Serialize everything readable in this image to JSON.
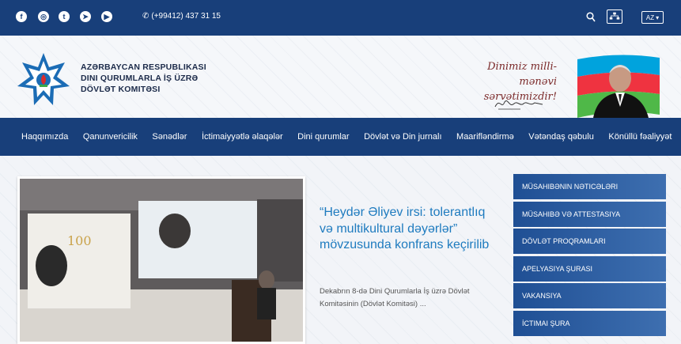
{
  "topbar": {
    "social_icons": [
      "facebook-icon",
      "instagram-icon",
      "twitter-icon",
      "telegram-icon",
      "youtube-icon"
    ],
    "phone": "(+99412) 437 31 15",
    "language": "AZ"
  },
  "header": {
    "org_line1": "Azərbaycan Respublikası",
    "org_line2": "Dini Qurumlarla İş üzrə",
    "org_line3": "Dövlət Komitəsi",
    "slogan_line1": "Dinimiz milli-mənəvi",
    "slogan_line2": "sərvətimizdir!"
  },
  "nav": {
    "items": [
      "Haqqımızda",
      "Qanunvericilik",
      "Sənədlər",
      "İctimaiyyətlə əlaqələr",
      "Dini qurumlar",
      "Dövlət və Din jurnalı",
      "Maarifləndirmə",
      "Vətəndaş qəbulu",
      "Könüllü fəaliyyət"
    ]
  },
  "news": {
    "title": "“Heydər Əliyev irsi: tolerantlıq və multikultural dəyərlər” mövzusunda konfrans keçirilib",
    "excerpt": "Dekabrın 8-də Dini Qurumlarla İş üzrə Dövlət Komitəsinin (Dövlət Komitəsi) ..."
  },
  "sidebar": {
    "items": [
      "Müsahibənin nəticələri",
      "Müsahibə və attestasiya",
      "Dövlət proqramları",
      "Apelyasiya şurası",
      "Vakansiya",
      "İctimai şura"
    ]
  },
  "colors": {
    "primary": "#183f7a",
    "sidebar": "#1f4f94",
    "title_blue": "#1e7bbf"
  }
}
